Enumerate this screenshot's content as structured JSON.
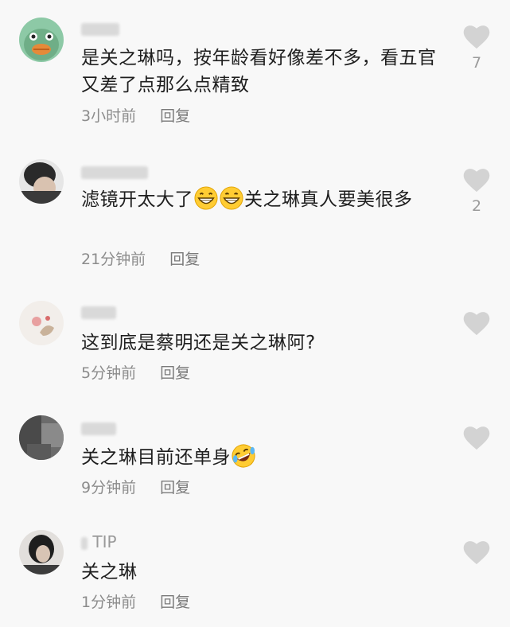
{
  "comments": [
    {
      "username": "",
      "text": "是关之琳吗，按年龄看好像差不多，看五官又差了点那么点精致",
      "time": "3小时前",
      "reply": "回复",
      "likes": "7"
    },
    {
      "username": "",
      "text_before": "滤镜开太大了",
      "text_after": "关之琳真人要美很多",
      "time": "21分钟前",
      "reply": "回复",
      "likes": "2"
    },
    {
      "username": "",
      "text": "这到底是蔡明还是关之琳阿?",
      "time": "5分钟前",
      "reply": "回复",
      "likes": ""
    },
    {
      "username": "",
      "text": "关之琳目前还单身",
      "time": "9分钟前",
      "reply": "回复",
      "likes": ""
    },
    {
      "username": "TIP",
      "text": "关之琳",
      "time": "1分钟前",
      "reply": "回复",
      "likes": ""
    }
  ],
  "icons": {
    "like": "heart-icon",
    "grin_emoji": "grinning-face-emoji",
    "laugh_emoji": "rolling-laughing-emoji"
  },
  "colors": {
    "background": "#f8f8f8",
    "heart": "#d3d3d3",
    "text": "#1f1f1f",
    "meta": "#8c8c8c"
  }
}
